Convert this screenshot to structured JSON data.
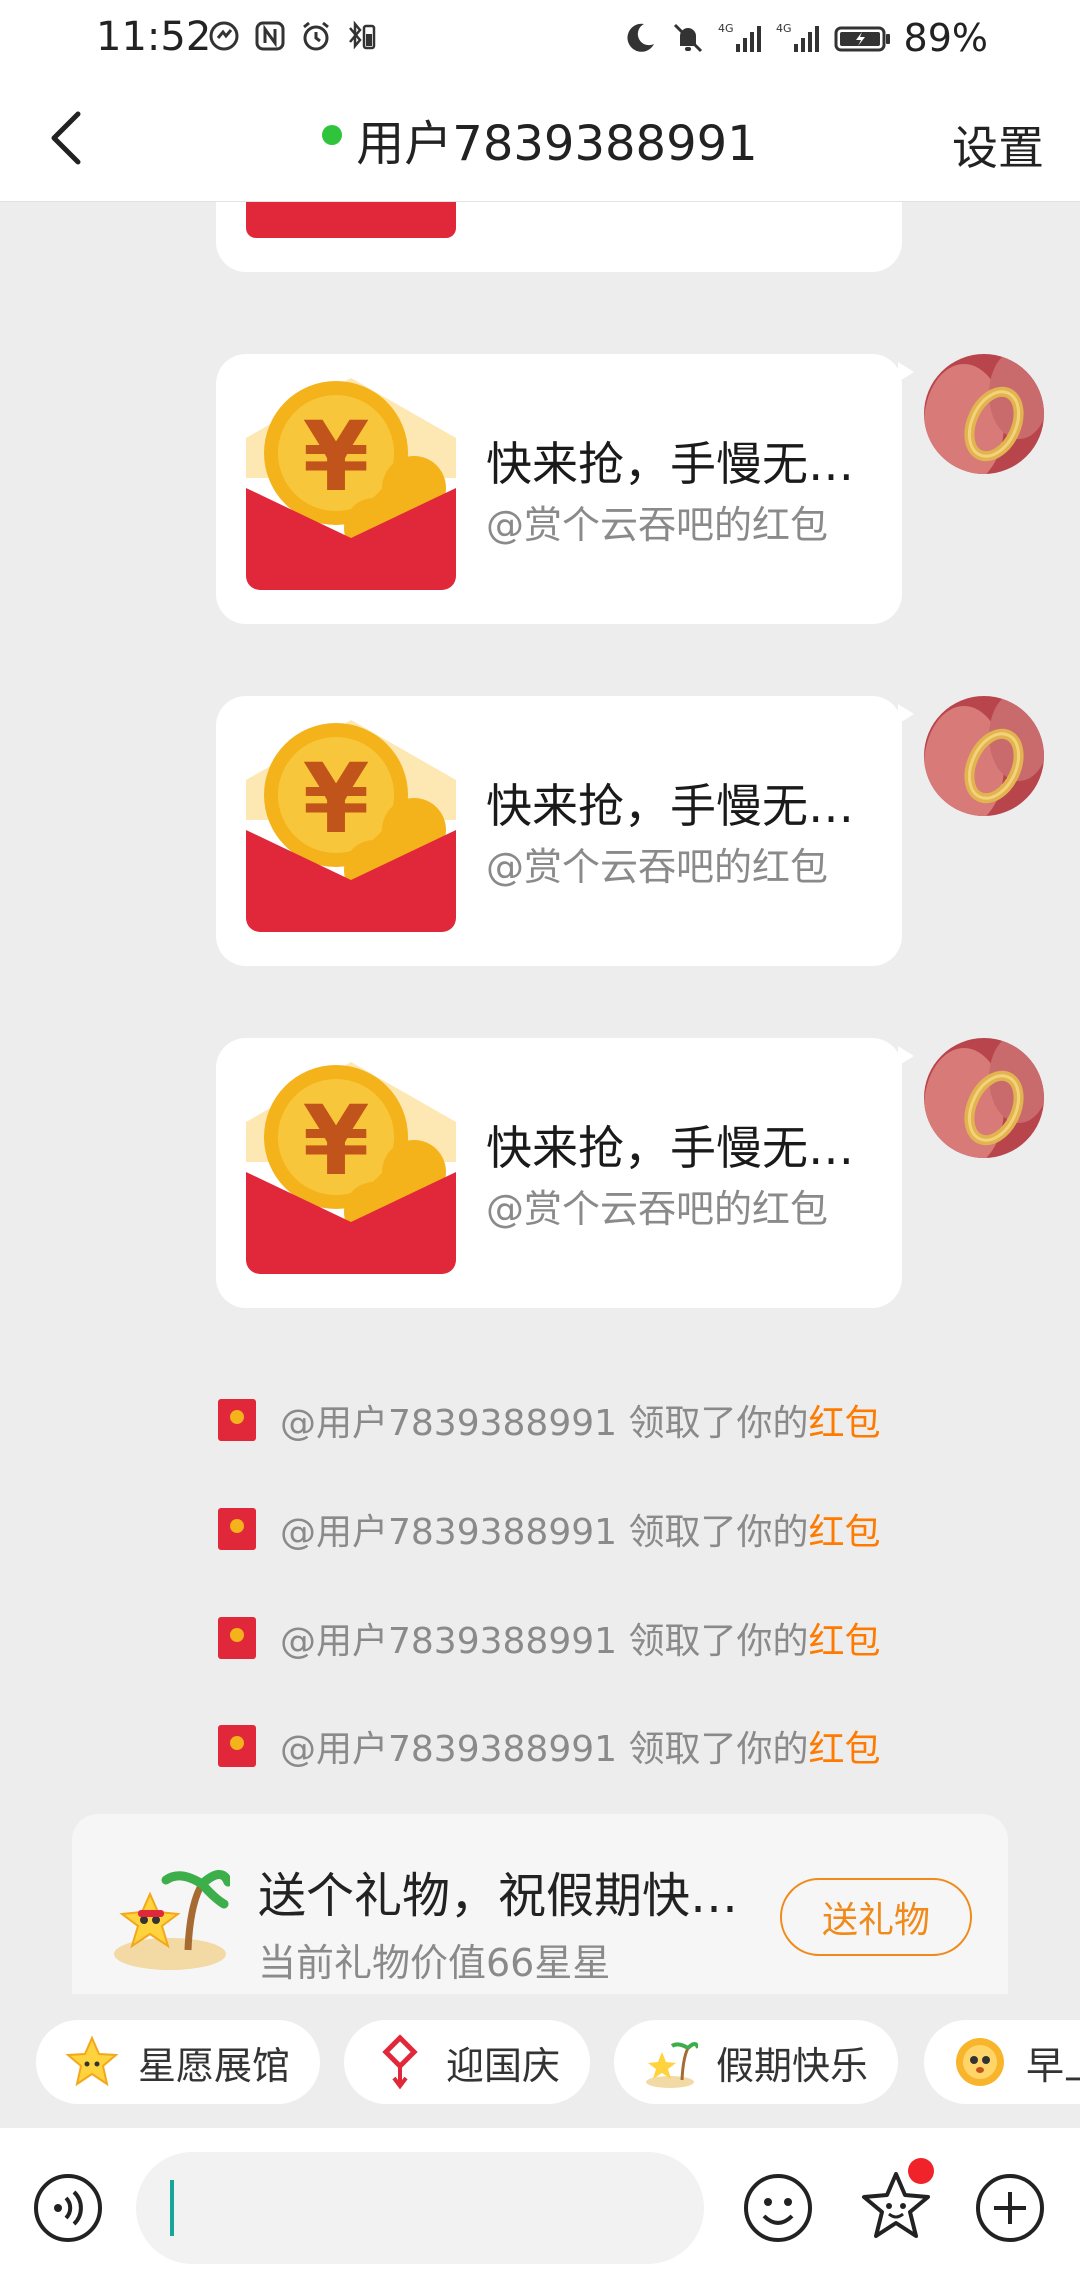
{
  "status_bar": {
    "time": "11:52",
    "battery": "89%",
    "network_1": "4G",
    "network_2": "4G"
  },
  "header": {
    "title": "用户7839388991",
    "settings": "设置",
    "online_color": "#2fc43b"
  },
  "messages": [
    {
      "title": "快来抢，手慢无…",
      "subtitle": "@赏个云吞吧的红包"
    },
    {
      "title": "快来抢，手慢无…",
      "subtitle": "@赏个云吞吧的红包"
    },
    {
      "title": "快来抢，手慢无…",
      "subtitle": "@赏个云吞吧的红包"
    }
  ],
  "notices": [
    {
      "text": "@用户7839388991 领取了你的",
      "link": "红包"
    },
    {
      "text": "@用户7839388991 领取了你的",
      "link": "红包"
    },
    {
      "text": "@用户7839388991 领取了你的",
      "link": "红包"
    },
    {
      "text": "@用户7839388991 领取了你的",
      "link": "红包"
    }
  ],
  "gift": {
    "title": "送个礼物，祝假期快…",
    "subtitle": "当前礼物价值66星星",
    "button": "送礼物"
  },
  "chips": [
    {
      "label": "星愿展馆",
      "icon": "star-face-icon"
    },
    {
      "label": "迎国庆",
      "icon": "chinese-knot-icon"
    },
    {
      "label": "假期快乐",
      "icon": "holiday-star-icon"
    },
    {
      "label": "早上",
      "icon": "sun-face-icon"
    }
  ],
  "input": {
    "value": "",
    "placeholder": ""
  },
  "colors": {
    "accent_orange": "#ff7a00",
    "envelope_red": "#e0283a",
    "coin_gold": "#f5b31b"
  }
}
